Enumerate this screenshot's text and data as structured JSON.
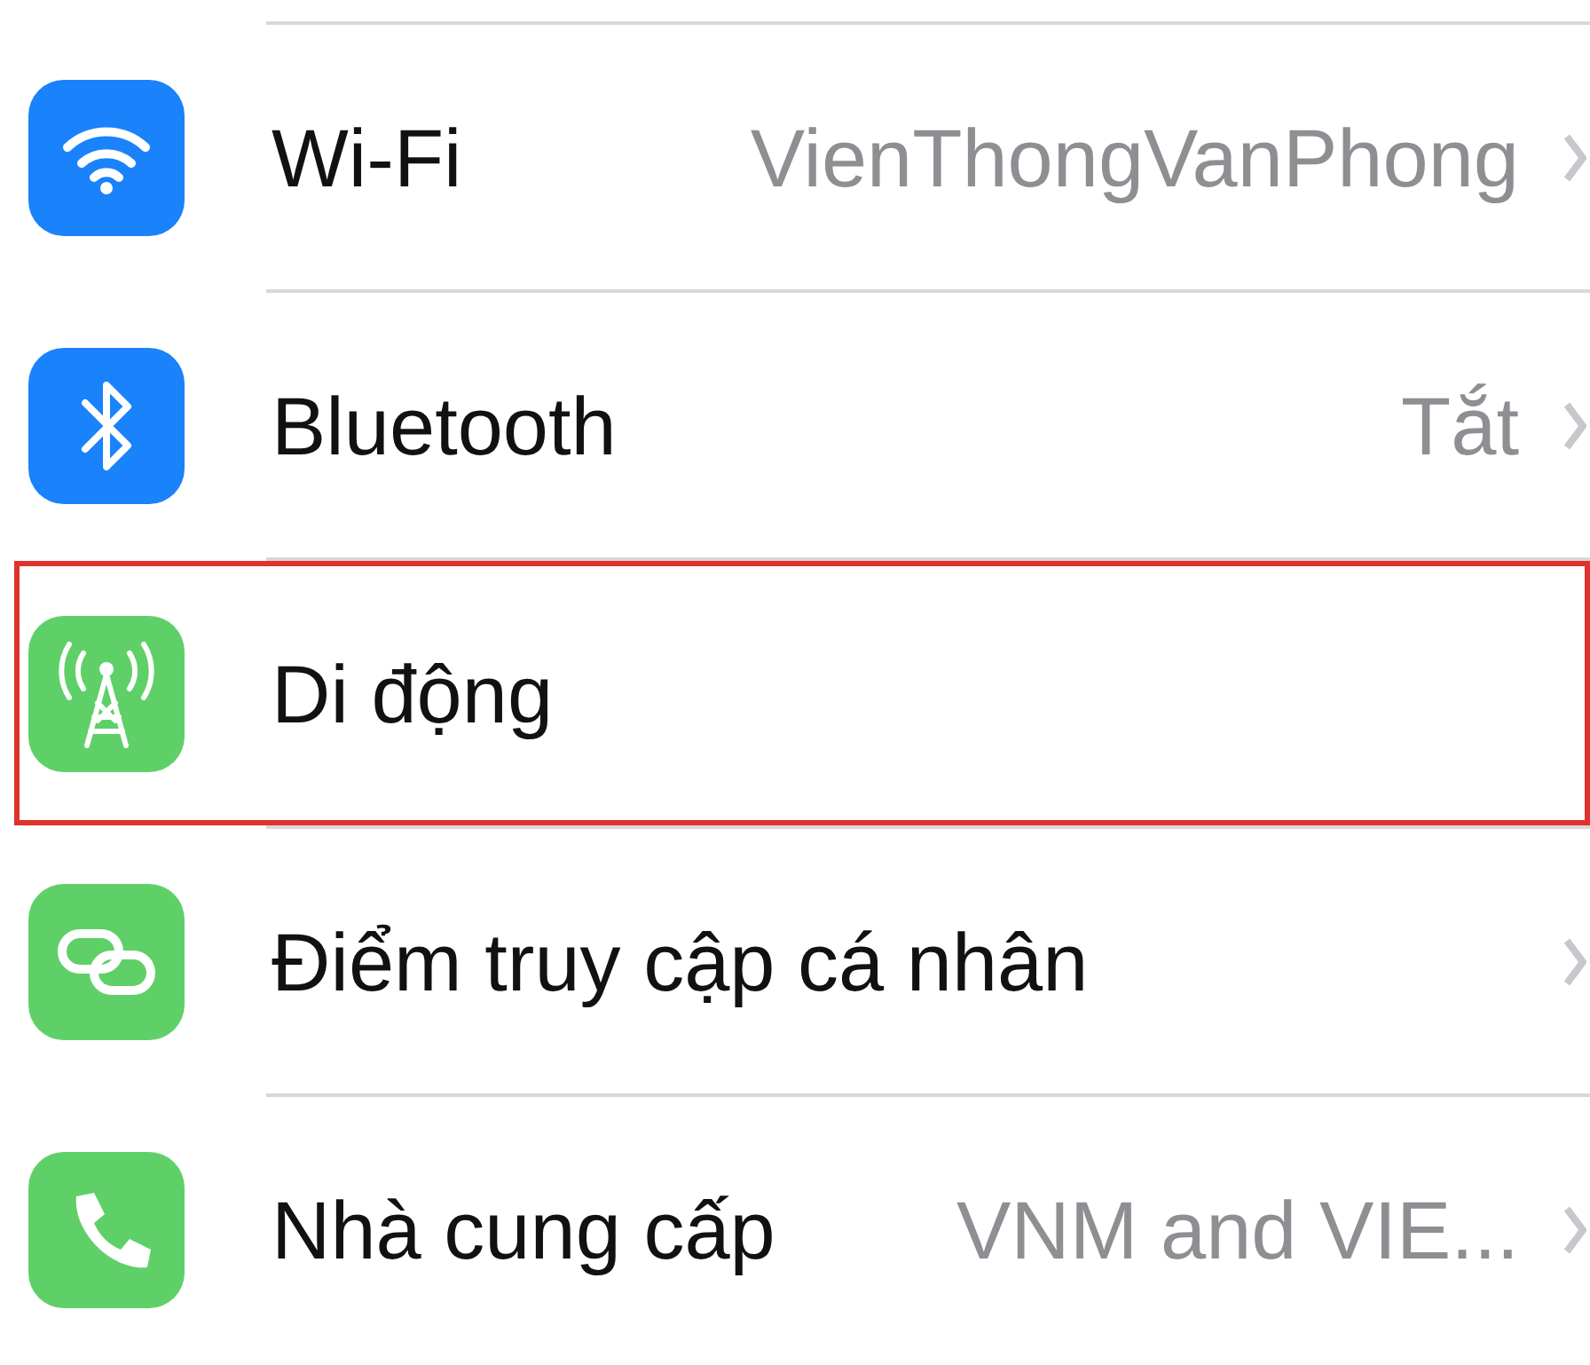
{
  "rows": [
    {
      "kind": "wifi",
      "color": "#1a82fb",
      "label": "Wi-Fi",
      "value": "VienThongVanPhong",
      "chevron": true,
      "highlighted": false
    },
    {
      "kind": "bluetooth",
      "color": "#1a82fb",
      "label": "Bluetooth",
      "value": "Tắt",
      "chevron": true,
      "highlighted": false
    },
    {
      "kind": "antenna",
      "color": "#5fd068",
      "label": "Di động",
      "chevron": false,
      "highlighted": true
    },
    {
      "kind": "link",
      "color": "#5fd068",
      "label": "Điểm truy cập cá nhân",
      "chevron": true,
      "highlighted": false
    },
    {
      "kind": "phone",
      "color": "#5fd068",
      "label": "Nhà cung cấp",
      "value": "VNM and VIE...",
      "chevron": true,
      "highlighted": false
    }
  ]
}
